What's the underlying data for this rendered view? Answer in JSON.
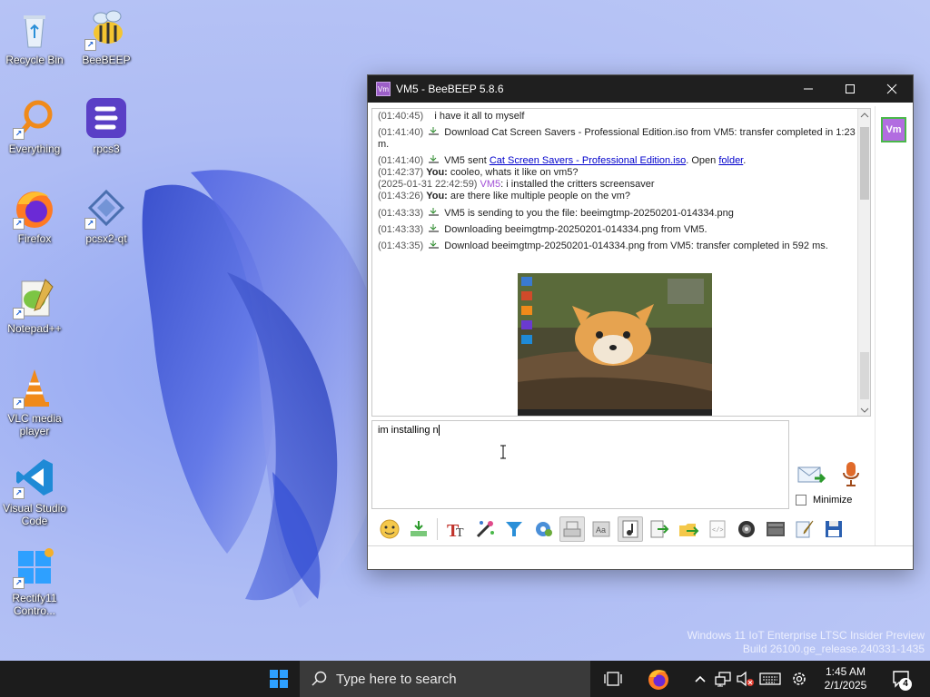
{
  "desktop": {
    "icons": [
      {
        "label": "Recycle Bin"
      },
      {
        "label": "BeeBEEP"
      },
      {
        "label": "Everything"
      },
      {
        "label": "rpcs3"
      },
      {
        "label": "Firefox"
      },
      {
        "label": "pcsx2-qt"
      },
      {
        "label": "Notepad++"
      },
      {
        "label": "VLC media player"
      },
      {
        "label": "Visual Studio Code"
      },
      {
        "label": "Rectify11 Contro..."
      }
    ],
    "watermark": {
      "line1": "Windows 11 IoT Enterprise LTSC Insider Preview",
      "line2": "Build 26100.ge_release.240331-1435"
    }
  },
  "window": {
    "title": "VM5 - BeeBEEP 5.8.6",
    "app_icon_text": "Vm",
    "avatar_text": "Vm",
    "messages": [
      {
        "ts": "(01:40:45)",
        "text": "i have it all to myself"
      },
      {
        "ts": "(01:41:40)",
        "text": "Download Cat Screen Savers - Professional Edition.iso from VM5: transfer completed in 1:23 m."
      },
      {
        "ts": "(01:41:40)",
        "pre": "VM5 sent ",
        "link": "Cat Screen Savers - Professional Edition.iso",
        "mid": ". Open ",
        "link2": "folder",
        "post": "."
      },
      {
        "ts": "(01:42:37)",
        "who": "You:",
        "text": "cooleo, whats it like on vm5?"
      },
      {
        "ts": "(2025-01-31 22:42:59)",
        "who": "VM5",
        "text": ": i installed the critters screensaver"
      },
      {
        "ts": "(01:43:26)",
        "who": "You:",
        "text": "are there like multiple people on the vm?"
      },
      {
        "ts": "(01:43:33)",
        "text": "VM5 is sending to you the file: beeimgtmp-20250201-014334.png"
      },
      {
        "ts": "(01:43:33)",
        "text": "Downloading beeimgtmp-20250201-014334.png from VM5."
      },
      {
        "ts": "(01:43:35)",
        "text": "Download beeimgtmp-20250201-014334.png from VM5: transfer completed in 592 ms."
      }
    ],
    "input_value": "im installing n",
    "minimize_label": "Minimize"
  },
  "taskbar": {
    "search_placeholder": "Type here to search",
    "time": "1:45 AM",
    "date": "2/1/2025",
    "notification_count": "4"
  },
  "colors": {
    "taskbar": "#1c1c1c",
    "titlebar": "#1f1f1f",
    "accent_purple": "#a14fd6",
    "link": "#0000cc"
  }
}
